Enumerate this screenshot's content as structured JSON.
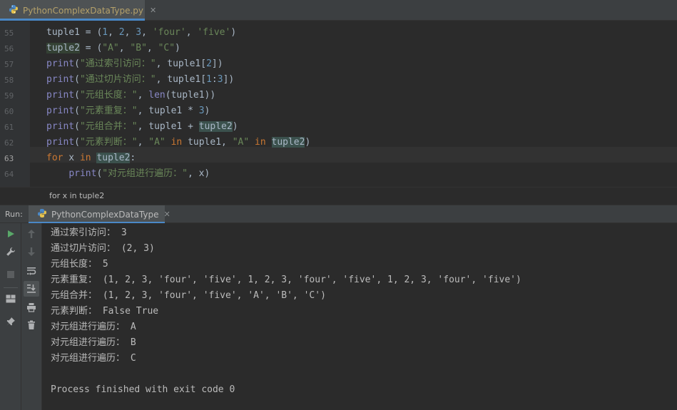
{
  "editor_tab": {
    "filename": "PythonComplexDataType.py"
  },
  "editor": {
    "line_numbers": [
      "55",
      "56",
      "57",
      "58",
      "59",
      "60",
      "61",
      "62",
      "63",
      "64"
    ],
    "current_line": "63",
    "lines": [
      [
        "tuple1",
        " = (",
        "1",
        ", ",
        "2",
        ", ",
        "3",
        ", ",
        "'four'",
        ", ",
        "'five'",
        ")"
      ],
      [
        "tuple2",
        " = (",
        "\"A\"",
        ", ",
        "\"B\"",
        ", ",
        "\"C\"",
        ")"
      ],
      [
        "print",
        "(",
        "\"通过索引访问：\"",
        ", tuple1[",
        "2",
        "])"
      ],
      [
        "print",
        "(",
        "\"通过切片访问：\"",
        ", tuple1[",
        "1",
        ":",
        "3",
        "])"
      ],
      [
        "print",
        "(",
        "\"元组长度：\"",
        ", ",
        "len",
        "(tuple1))"
      ],
      [
        "print",
        "(",
        "\"元素重复：\"",
        ", tuple1 * ",
        "3",
        ")"
      ],
      [
        "print",
        "(",
        "\"元组合并：\"",
        ", tuple1 + ",
        "tuple2",
        ")"
      ],
      [
        "print",
        "(",
        "\"元素判断：\"",
        ", ",
        "\"A\"",
        " ",
        "in",
        " tuple1, ",
        "\"A\"",
        " ",
        "in",
        " ",
        "tuple2",
        ")"
      ],
      [
        "for",
        " x ",
        "in",
        " ",
        "tuple2",
        ":"
      ],
      [
        "    ",
        "print",
        "(",
        "\"对元组进行遍历：\"",
        ", x)"
      ]
    ]
  },
  "breadcrumb": {
    "text": "for x in tuple2"
  },
  "run_panel": {
    "label": "Run:",
    "tab_label": "PythonComplexDataType",
    "output": [
      "通过索引访问： 3",
      "通过切片访问： (2, 3)",
      "元组长度： 5",
      "元素重复： (1, 2, 3, 'four', 'five', 1, 2, 3, 'four', 'five', 1, 2, 3, 'four', 'five')",
      "元组合并： (1, 2, 3, 'four', 'five', 'A', 'B', 'C')",
      "元素判断： False True",
      "对元组进行遍历： A",
      "对元组进行遍历： B",
      "对元组进行遍历： C",
      "",
      "Process finished with exit code 0"
    ]
  },
  "icons": {
    "file_type": "python-file-icon",
    "toolbar_left": [
      "rerun-icon",
      "wrench-icon",
      "stop-icon",
      "layout-icon",
      "pin-icon"
    ],
    "toolbar_right": [
      "up-arrow-icon",
      "down-arrow-icon",
      "soft-wrap-icon",
      "scroll-to-end-icon",
      "print-icon",
      "trash-icon"
    ]
  },
  "colors": {
    "accent": "#4a88c7",
    "run_green": "#59a869",
    "keyword": "#cc7832",
    "string": "#6a8759",
    "number": "#6897bb"
  }
}
